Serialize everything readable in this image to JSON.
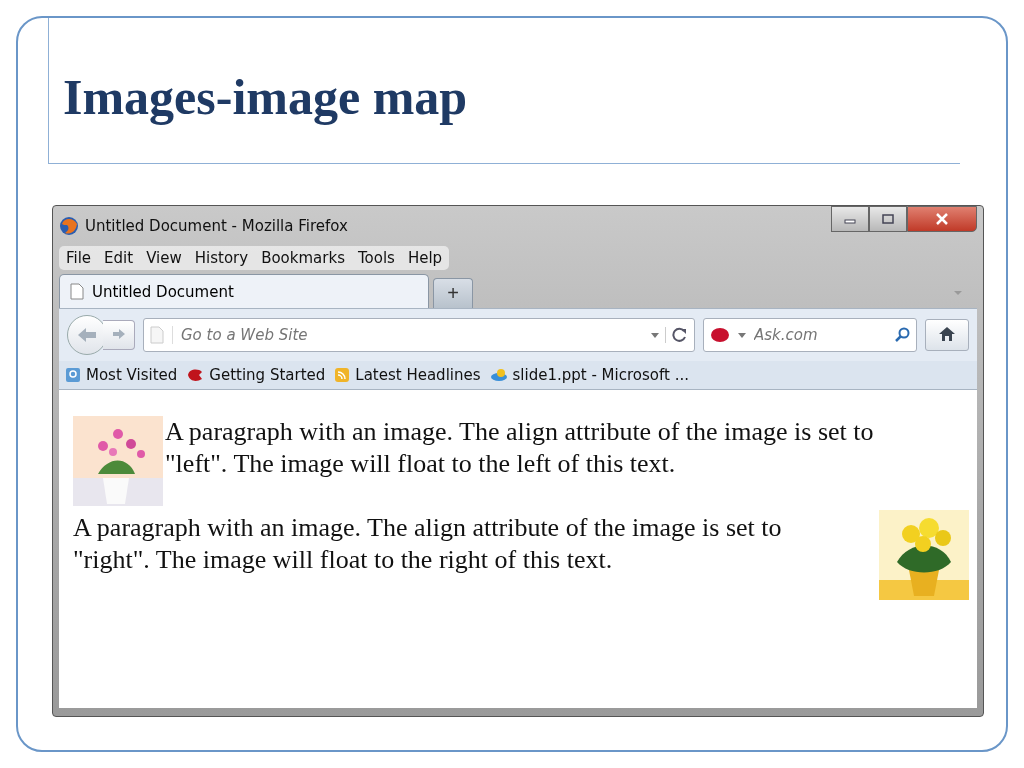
{
  "slide": {
    "title": "Images-image map"
  },
  "window": {
    "title": "Untitled Document - Mozilla Firefox"
  },
  "menu": [
    "File",
    "Edit",
    "View",
    "History",
    "Bookmarks",
    "Tools",
    "Help"
  ],
  "tabs": [
    {
      "label": "Untitled Document",
      "selected": true
    }
  ],
  "new_tab": "+",
  "address_bar": {
    "placeholder": "Go to a Web Site"
  },
  "search": {
    "placeholder": "Ask.com"
  },
  "bookmarks": [
    {
      "label": "Most Visited",
      "kind": "folder"
    },
    {
      "label": "Getting Started",
      "kind": "start"
    },
    {
      "label": "Latest Headlines",
      "kind": "feed"
    },
    {
      "label": "slide1.ppt - Microsoft ...",
      "kind": "link"
    }
  ],
  "page": {
    "paragraphs": [
      {
        "text": "A paragraph with an image. The align attribute of the image is set to \"left\". The image will float to the left of this text.",
        "kind": "image-left"
      },
      {
        "text": "A paragraph with an image. The align attribute of the image is set to \"right\". The image will float to the right of this text.",
        "kind": "image-right"
      }
    ]
  }
}
